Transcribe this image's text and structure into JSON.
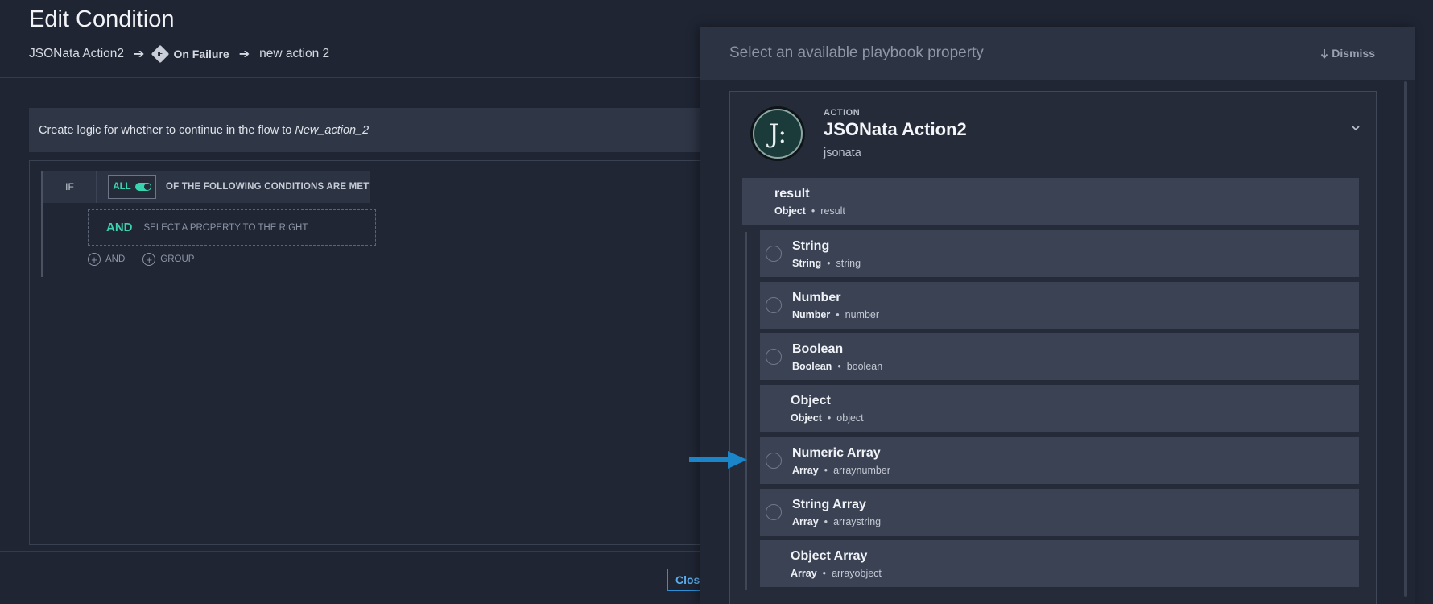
{
  "page": {
    "title": "Edit Condition",
    "breadcrumb": {
      "first": "JSONata Action2",
      "arrow": "➔",
      "badge": "IF",
      "second": "On Failure",
      "third": "new action 2"
    },
    "info_prefix": "Create logic for whether to continue in the flow to",
    "info_target": "New_action_2"
  },
  "condition": {
    "if_label": "IF",
    "all_label": "ALL",
    "conditions_text": "OF THE FOLLOWING CONDITIONS ARE MET",
    "and_label": "AND",
    "and_hint": "SELECT A PROPERTY TO THE RIGHT",
    "add_and": "AND",
    "add_group": "GROUP"
  },
  "footer": {
    "close_label": "Close"
  },
  "panel": {
    "title": "Select an available playbook property",
    "dismiss": "Dismiss",
    "action": {
      "kind": "ACTION",
      "name": "JSONata Action2",
      "sub": "jsonata",
      "logo_glyph": "J:"
    },
    "result": {
      "name": "result",
      "type": "Object",
      "path": "result"
    },
    "properties": [
      {
        "name": "String",
        "type": "String",
        "path": "string",
        "radio": true
      },
      {
        "name": "Number",
        "type": "Number",
        "path": "number",
        "radio": true
      },
      {
        "name": "Boolean",
        "type": "Boolean",
        "path": "boolean",
        "radio": true
      },
      {
        "name": "Object",
        "type": "Object",
        "path": "object",
        "radio": false
      },
      {
        "name": "Numeric Array",
        "type": "Array",
        "path": "arraynumber",
        "radio": true
      },
      {
        "name": "String Array",
        "type": "Array",
        "path": "arraystring",
        "radio": true
      },
      {
        "name": "Object Array",
        "type": "Array",
        "path": "arrayobject",
        "radio": false
      }
    ]
  },
  "colors": {
    "accent": "#39d3b0",
    "link": "#2d8fd5",
    "annotation_arrow": "#1a86c9"
  }
}
